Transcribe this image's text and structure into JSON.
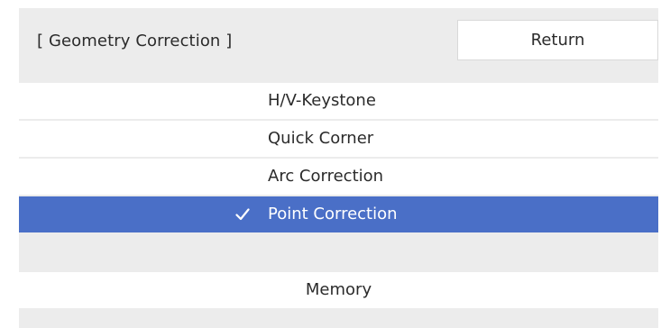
{
  "header": {
    "title": "[ Geometry Correction ]",
    "return_label": "Return"
  },
  "menu": {
    "items": [
      {
        "label": "H/V-Keystone",
        "selected": false
      },
      {
        "label": "Quick Corner",
        "selected": false
      },
      {
        "label": "Arc Correction",
        "selected": false
      },
      {
        "label": "Point Correction",
        "selected": true,
        "icon": "checkmark-icon"
      }
    ],
    "memory_label": "Memory"
  },
  "colors": {
    "background": "#ececec",
    "item_background": "#ffffff",
    "selected_background": "#4a6fc7",
    "selected_text": "#ffffff",
    "text": "#2b2b2b"
  }
}
